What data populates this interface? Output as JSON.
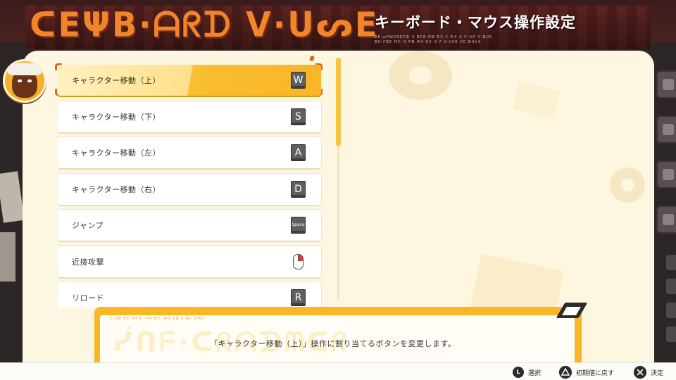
{
  "header": {
    "decorative_title": "ᑕEΨB·ᗩᖇᗪ ᐯ·ᑌᔕE",
    "title": "キーボード・マウス操作設定",
    "decorative_subtext": [
      "ᗷE·ᔕᗩᗯᑕᗷEᑕᗪ ᐊ·ᗷᑕE·ᗩᗷ ᗪᑕ·ᕈ ᗪᐊ·ᐊ ᐯ·ᑌᗩ ᐯ·ᗷᑌE",
      "ᗷᑌ·ᕈᗪE ᗩᑕ ᐊ·ᗩᗷ ᗩᐊ·ᑕᐯ ᐊ·ᕈ ᐯ·ᑌᐯE ᐯᑕ ᗷᐊᐯᐊ"
    ]
  },
  "keybindings": [
    {
      "action": "キャラクター移動（上）",
      "key": "W",
      "selected": true
    },
    {
      "action": "キャラクター移動（下）",
      "key": "S",
      "selected": false
    },
    {
      "action": "キャラクター移動（左）",
      "key": "A",
      "selected": false
    },
    {
      "action": "キャラクター移動（右）",
      "key": "D",
      "selected": false
    },
    {
      "action": "ジャンプ",
      "key": "Space",
      "selected": false
    },
    {
      "action": "近接攻撃",
      "key": "mouse-left-click-icon",
      "selected": false
    },
    {
      "action": "リロード",
      "key": "R",
      "selected": false
    }
  ],
  "description": {
    "deco_line": "ᑕ·ᐯᗷ·ᗪE ᗩᐊᐊ ·ᐯᗩ·ᑌE ·ᗩᐊ·ᐯᗷ ᐯ·ᗷᕈ ᗪᗩᐯ",
    "watermark": "ᓰᑎᖴ·ᑕᖇᗩᗪᗰᑕᖇ",
    "text": "「キャラクター移動（上）」操作に割り当てるボタンを変更します。"
  },
  "footer": {
    "hints": [
      {
        "button": "L",
        "label": "選択"
      },
      {
        "button": "triangle-button-icon",
        "label": "初期値に戻す"
      },
      {
        "button": "cross-button-icon",
        "label": "決定"
      }
    ]
  },
  "colors": {
    "accent_orange": "#f0852a",
    "highlight_yellow": "#f9b625",
    "panel_cream": "#fdf6e0",
    "selection_bracket": "#e0681e"
  }
}
